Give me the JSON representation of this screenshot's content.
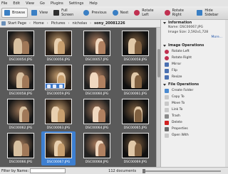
{
  "menu": [
    "File",
    "Edit",
    "View",
    "Go",
    "Plugins",
    "Settings",
    "Help"
  ],
  "toolbar": [
    {
      "label": "Browse",
      "icon": "browse-icon",
      "active": true,
      "color": "#3a7fc4"
    },
    {
      "label": "View",
      "icon": "view-icon",
      "color": "#3a7fc4"
    },
    {
      "label": "Full Screen",
      "icon": "fullscreen-icon",
      "color": "#2f2f2f"
    },
    {
      "label": "Previous",
      "icon": "previous-icon",
      "color": "#3a7fc4"
    },
    {
      "label": "Next",
      "icon": "next-icon",
      "color": "#3a7fc4"
    },
    {
      "label": "Rotate Left",
      "icon": "rotate-left-icon",
      "color": "#c03050"
    },
    {
      "label": "Rotate Right",
      "icon": "rotate-right-icon",
      "color": "#c03050"
    },
    {
      "label": "Hide Sidebar",
      "icon": "hide-sidebar-icon",
      "color": "#3a7fc4"
    }
  ],
  "breadcrumb": {
    "start": "Start Page",
    "parts": [
      "Home",
      "Pictures",
      "nicholas"
    ],
    "current": "sony_20081226"
  },
  "thumbnails": [
    {
      "name": "DSC00054.JPG"
    },
    {
      "name": "DSC00056.JPG"
    },
    {
      "name": "DSC00057.JPG"
    },
    {
      "name": "DSC00058.JPG"
    },
    {
      "name": "DSC00058.JPG"
    },
    {
      "name": "DSC00059.JPG"
    },
    {
      "name": "DSC00060.JPG"
    },
    {
      "name": "DSC00061.JPG"
    },
    {
      "name": "DSC00062.JPG"
    },
    {
      "name": "DSC00063.JPG"
    },
    {
      "name": "DSC00064.JPG"
    },
    {
      "name": "DSC00065.JPG"
    },
    {
      "name": "DSC00066.JPG"
    },
    {
      "name": "DSC00067.JPG",
      "selected": true
    },
    {
      "name": "DSC00068.JPG"
    },
    {
      "name": "DSC00069.JPG"
    }
  ],
  "sidebar": {
    "information_title": "Information",
    "name_line": "Name: DSC00067.JPG",
    "size_line": "Image Size: 2,592x1,728",
    "more_label": "More...",
    "image_ops_title": "Image Operations",
    "image_ops": [
      "Rotate Left",
      "Rotate Right",
      "Mirror",
      "Flip",
      "Resize"
    ],
    "file_ops_title": "File Operations",
    "file_ops": [
      "Create Folder",
      "Copy To",
      "Move To",
      "Link To",
      "Trash",
      "Delete",
      "Properties",
      "Open With"
    ]
  },
  "status": {
    "filter_label": "Filter by Name:",
    "count": "112 documents"
  },
  "colors": {
    "grid_bg": "#5a5a5a",
    "selection": "#3d7fd1"
  }
}
